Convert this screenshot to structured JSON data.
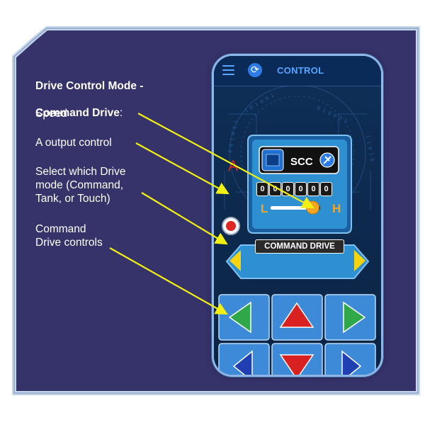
{
  "captions": {
    "title_line1": "Drive Control Mode -",
    "title_line2": "Command Drive",
    "title_suffix": ":",
    "speed": "Speed",
    "a_output": "A output control",
    "select_mode": "Select which Drive\nmode (Command,\nTank, or Touch)",
    "command_controls": "Command\nDrive controls"
  },
  "app": {
    "title": "CONTROL",
    "menu_icon": "hamburger-menu-icon",
    "sync_icon": "sync-icon"
  },
  "panel": {
    "device_label": "SCC",
    "counter_digits": [
      "0",
      "0",
      "0",
      "0",
      "0",
      "0"
    ],
    "output_label": "A",
    "speed_low_label": "L",
    "speed_high_label": "H",
    "speed_level": 0.85
  },
  "mode_selector": {
    "label": "COMMAND DRIVE",
    "prev_icon": "triangle-left-icon",
    "next_icon": "triangle-right-icon"
  },
  "controls": [
    {
      "name": "rotate-left",
      "icon": "rotate-left-triangle-icon",
      "color": "#2fa84a"
    },
    {
      "name": "forward",
      "icon": "arrow-up-triangle-icon",
      "color": "#d92121"
    },
    {
      "name": "rotate-right",
      "icon": "rotate-right-triangle-icon",
      "color": "#2fa84a"
    },
    {
      "name": "left",
      "icon": "arrow-left-triangle-icon",
      "color": "#1f3fb3"
    },
    {
      "name": "backward",
      "icon": "arrow-down-triangle-icon",
      "color": "#d92121"
    },
    {
      "name": "right",
      "icon": "arrow-right-triangle-icon",
      "color": "#1f3fb3"
    }
  ],
  "colors": {
    "frame": "#36326a",
    "frame_border": "#b9cde8",
    "phone_bg": "#0f2f57",
    "panel": "#2e8fd1",
    "accent": "#5aa5ff",
    "arrow": "#f2ef12"
  }
}
